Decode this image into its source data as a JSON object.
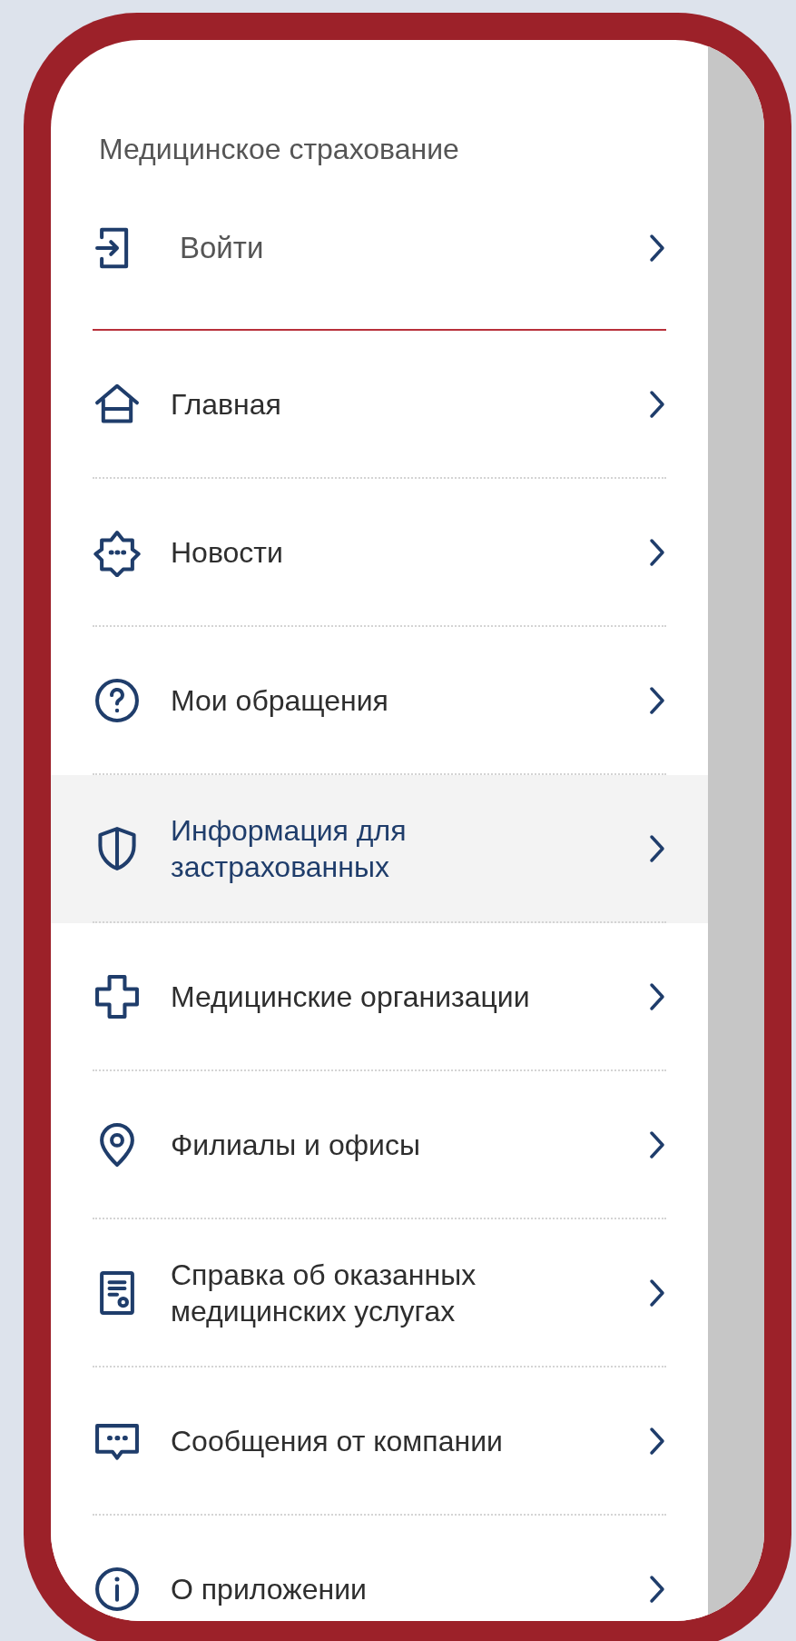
{
  "header": {
    "title": "Медицинское страхование"
  },
  "menu": [
    {
      "kind": "login",
      "label": "Войти",
      "selected": false
    },
    {
      "kind": "nav",
      "label": "Главная",
      "selected": false
    },
    {
      "kind": "nav",
      "label": "Новости",
      "selected": false
    },
    {
      "kind": "nav",
      "label": "Мои обращения",
      "selected": false
    },
    {
      "kind": "nav",
      "label": "Информация для застрахованных",
      "selected": true
    },
    {
      "kind": "nav",
      "label": "Медицинские организации",
      "selected": false
    },
    {
      "kind": "nav",
      "label": "Филиалы и офисы",
      "selected": false
    },
    {
      "kind": "nav",
      "label": "Справка об оказанных медицинских услугах",
      "selected": false
    },
    {
      "kind": "nav",
      "label": "Сообщения от компании",
      "selected": false
    },
    {
      "kind": "nav",
      "label": "О приложении",
      "selected": false
    }
  ]
}
